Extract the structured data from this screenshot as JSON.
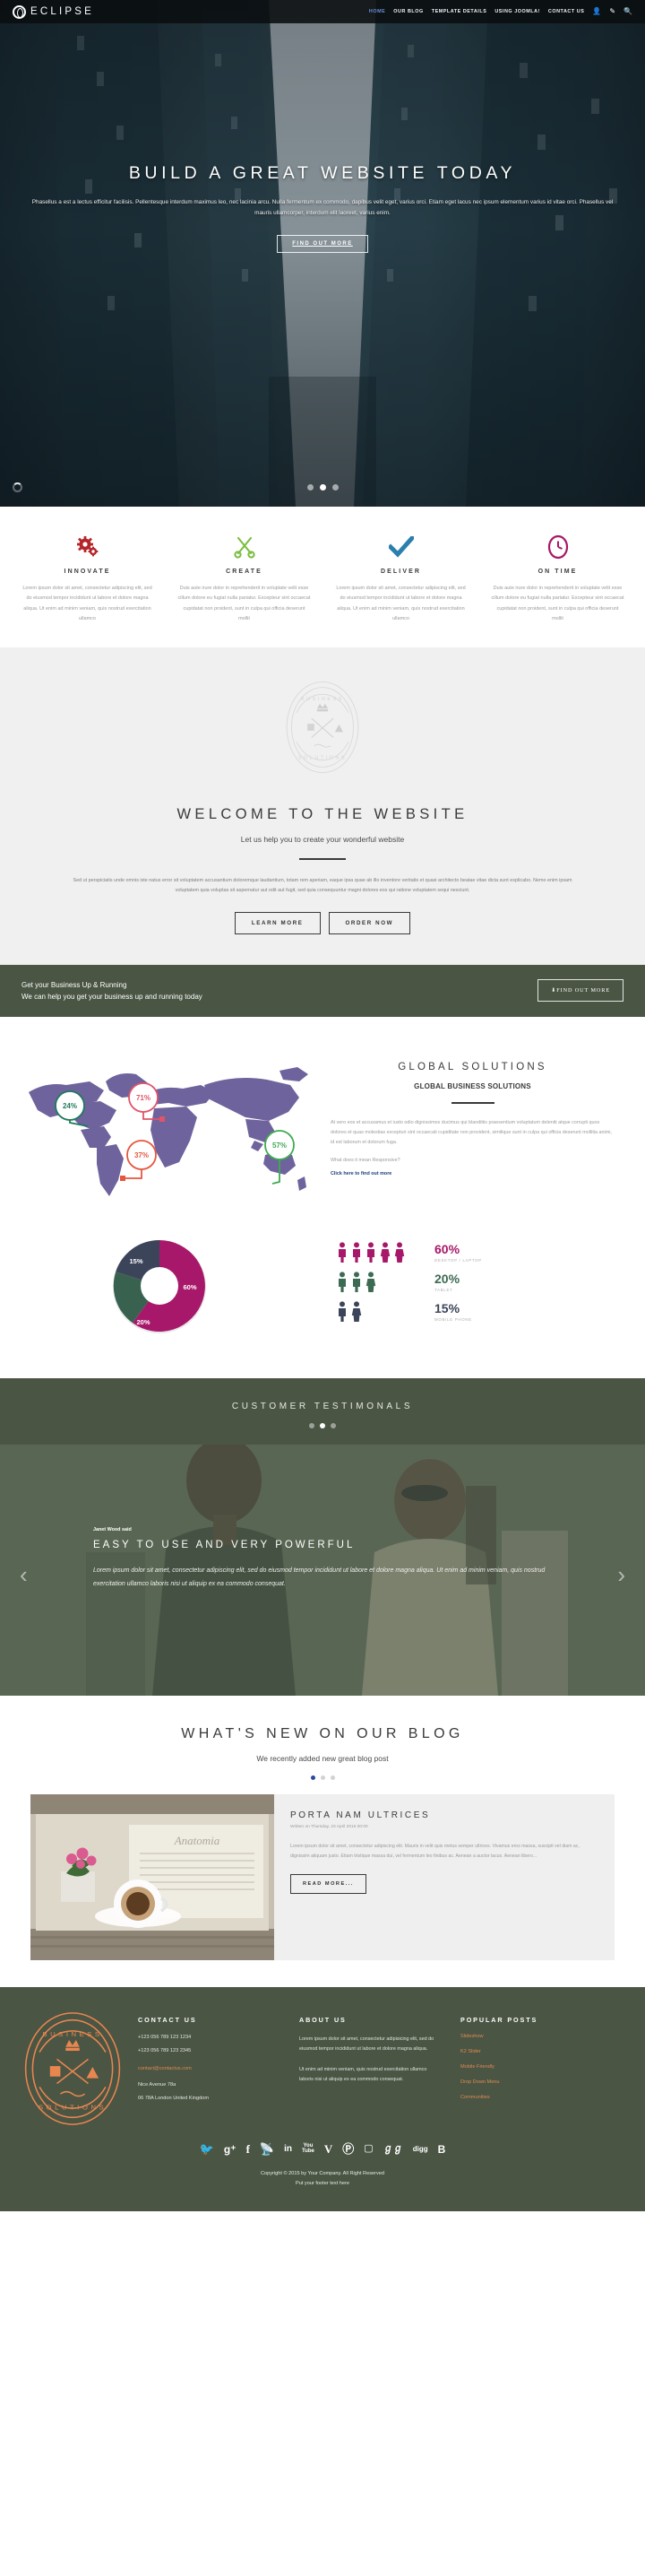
{
  "header": {
    "logo_text": "ECLIPSE",
    "nav": [
      {
        "label": "HOME",
        "active": true
      },
      {
        "label": "OUR BLOG",
        "active": false
      },
      {
        "label": "TEMPLATE DETAILS",
        "active": false
      },
      {
        "label": "USING JOOMLA!",
        "active": false
      },
      {
        "label": "CONTACT US",
        "active": false
      }
    ],
    "icons": [
      "user-icon",
      "pencil-icon",
      "search-icon"
    ]
  },
  "hero": {
    "title": "BUILD A GREAT WEBSITE TODAY",
    "paragraph": "Phasellus a est a lectus efficitur facilisis. Pellentesque interdum maximus leo, nec lacinia arcu. Nulla fermentum ex commodo, dapibus velit eget, varius orci. Etiam eget lacus nec ipsum elementum varius id vitae orci. Phasellus vel mauris ullamcorper, interdum elit laoreet, varius enim.",
    "button": "FIND OUT MORE",
    "slides": 3,
    "active_slide": 2
  },
  "features": [
    {
      "icon": "gears-icon",
      "color": "#b5262b",
      "title": "INNOVATE",
      "text": "Lorem ipsum dolor sit amet, consectetur adipiscing elit, sed do eiusmod tempor incididunt ut labore et dolore magna aliqua. Ut enim ad minim veniam, quis nostrud exercitation ullamco"
    },
    {
      "icon": "scissors-icon",
      "color": "#7bbd3f",
      "title": "CREATE",
      "text": "Duis aute irure dolor in reprehenderit in voluptate velit esse cillum dolore eu fugiat nulla pariatur. Excepteur sint occaecat cupidatat non proident, sunt in culpa qui officia deserunt mollit"
    },
    {
      "icon": "check-icon",
      "color": "#2a7fae",
      "title": "DELIVER",
      "text": "Lorem ipsum dolor sit amet, consectetur adipiscing elit, sed do eiusmod tempor incididunt ut labore et dolore magna aliqua. Ut enim ad minim veniam, quis nostrud exercitation ullamco"
    },
    {
      "icon": "clock-icon",
      "color": "#a7186a",
      "title": "ON TIME",
      "text": "Duis aute irure dolor in reprehenderit in voluptate velit esse cillum dolore eu fugiat nulla pariatur. Excepteur sint occaecat cupidatat non proident, sunt in culpa qui officia deserunt mollit"
    }
  ],
  "welcome": {
    "seal_top": "BUSINESS",
    "seal_bottom": "SOLUTIONS",
    "title": "WELCOME TO THE WEBSITE",
    "subtitle": "Let us help you to create your wonderful website",
    "body": "Sed ut perspiciatis unde omnis iste natus error sit voluptatem accusantium doloremque laudantium, totam rem aperiam, eaque ipsa quae ab illo inventore veritatis et quasi architecto beatae vitae dicta sunt explicabo. Nemo enim ipsam voluptatem quia voluptas sit aspernatur aut odit aut fugit, sed quia consequuntur magni dolores eos qui ratione voluptatem sequi nesciunt.",
    "btn_primary": "LEARN MORE",
    "btn_secondary": "ORDER NOW"
  },
  "cta": {
    "line1": "Get your Business Up & Running",
    "line2": "We can help you get your business up and running today",
    "button": "FIND OUT MORE"
  },
  "global": {
    "title": "GLOBAL SOLUTIONS",
    "subtitle": "GLOBAL BUSINESS SOLUTIONS",
    "body": "At vero eos et accusamus et iusto odio dignissimos ducimus qui blanditiis praesentium voluptatum deleniti atque corrupti quos dolores et quas molestias excepturi sint occaecati cupiditate non provident, similique sunt in culpa qui officia deserunt mollitia animi, id est laborum et dolorum fuga.",
    "question": "What does it mean Responsive?",
    "link": "Click here to find out more"
  },
  "chart_data": [
    {
      "type": "pie",
      "title": "Device usage share",
      "labels": [
        "Desktop / Laptop",
        "Mobile Phone",
        "Tablet"
      ],
      "values": [
        60,
        15,
        20
      ],
      "colors": [
        "#a7186a",
        "#3b4459",
        "#38624f"
      ],
      "data_labels": [
        "60%",
        "15%",
        "20%"
      ],
      "donut": true,
      "legend": "right"
    },
    {
      "type": "bar",
      "title": "Device usage pictogram",
      "categories": [
        "DESKTOP / LAPTOP",
        "TABLET",
        "MOBILE PHONE"
      ],
      "values": [
        60,
        20,
        15
      ],
      "data_labels": [
        "60%",
        "20%",
        "15%"
      ],
      "icon_counts": [
        5,
        3,
        2
      ],
      "colors": [
        "#a7186a",
        "#3d6a52",
        "#3b4459"
      ],
      "ylabel": "",
      "xlabel": ""
    },
    {
      "type": "scatter",
      "title": "World map regional percentages",
      "points": [
        {
          "label": "24%",
          "region": "North America",
          "value": 24,
          "color": "#1f7a5c",
          "x": 20,
          "y": 34
        },
        {
          "label": "71%",
          "region": "Europe",
          "value": 71,
          "color": "#e0546a",
          "x": 44,
          "y": 27
        },
        {
          "label": "37%",
          "region": "South America",
          "value": 37,
          "color": "#e4573f",
          "x": 43,
          "y": 64
        },
        {
          "label": "57%",
          "region": "Australia",
          "value": 57,
          "color": "#3faa52",
          "x": 88,
          "y": 57
        }
      ],
      "map_color": "#6e639c"
    }
  ],
  "testimonials": {
    "heading": "CUSTOMER TESTIMONALS",
    "dots": 3,
    "active_dot": 2,
    "author": "Janet Wood said",
    "title": "EASY TO USE AND VERY POWERFUL",
    "quote": "Lorem ipsum dolor sit amet, consectetur adipiscing elit, sed do eiusmod tempor incididunt ut labore et dolore magna aliqua. Ut enim ad minim veniam, quis nostrud exercitation ullamco laboris nisi ut aliquip ex ea commodo consequat.",
    "prev": "‹",
    "next": "›"
  },
  "blog": {
    "title": "WHAT'S NEW ON OUR BLOG",
    "subtitle": "We recently added new great blog post",
    "dots": 3,
    "active_dot": 1,
    "post": {
      "title": "PORTA NAM ULTRICES",
      "meta": "Written on Thursday, 23 April 2015 00:00",
      "excerpt": "Lorem ipsum dolor sit amet, consectetur adipiscing elit. Mauris in velit quis metus semper ultrices. Vivamus eros massa, suscipit vel diam ac, dignissim aliquam justo. Etiam tristique massa dui, vel fermentum leo finibus ac. Aenean a auctor lacus. Aenean libero...",
      "button": "READ MORE..."
    }
  },
  "footer": {
    "seal_top": "BUSINESS",
    "seal_bottom": "SOLUTIONS",
    "contact": {
      "heading": "CONTACT US",
      "phone1": "+123 056 789 123 1234",
      "phone2": "+123 056 789 123 2345",
      "email": "contact@contactus.com",
      "address1": "Nice Avenue 78a",
      "address2": "06 78A London United Kingdom"
    },
    "about": {
      "heading": "ABOUT US",
      "p1": "Lorem ipsum dolor sit amet, consectetur adipisicing elit, sed do eiusmod tempor incididunt ut labore et dolore magna aliqua.",
      "p2": "Ut enim ad minim veniam, quis nostrud exercitation ullamco laboris nisi ut aliquip ex ea commodo consequat."
    },
    "popular": {
      "heading": "POPULAR POSTS",
      "items": [
        "Slideshow",
        "K2 Slider",
        "Mobile Friendly",
        "Drop Down Menu",
        "Communities"
      ]
    },
    "social": [
      "twitter-icon",
      "googleplus-icon",
      "facebook-icon",
      "rss-icon",
      "linkedin-icon",
      "youtube-icon",
      "vimeo-icon",
      "pinterest-icon",
      "instagram-icon",
      "stumbleupon-icon",
      "digg-icon",
      "blogger-icon"
    ],
    "copyright": "Copyright © 2015 by Your Company. All Right Reserved",
    "footer_text": "Put your footer text here"
  }
}
